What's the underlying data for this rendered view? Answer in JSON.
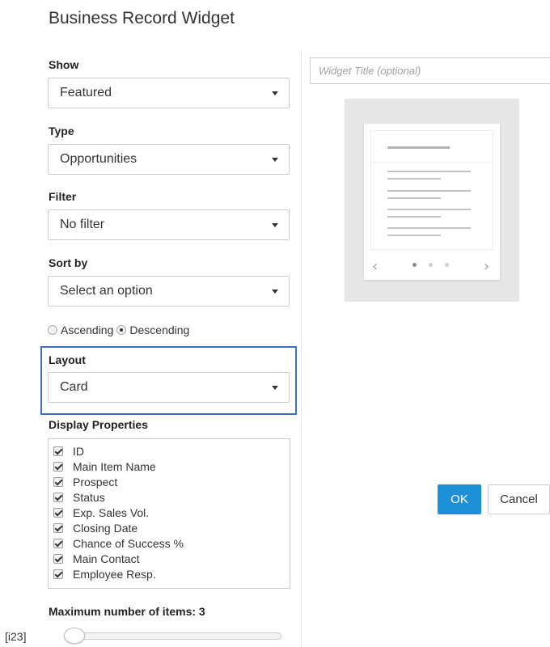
{
  "page_title": "Business Record Widget",
  "show": {
    "label": "Show",
    "value": "Featured"
  },
  "type": {
    "label": "Type",
    "value": "Opportunities"
  },
  "filter": {
    "label": "Filter",
    "value": "No filter"
  },
  "sort_by": {
    "label": "Sort by",
    "value": "Select an option",
    "order_options": [
      {
        "label": "Ascending",
        "selected": false
      },
      {
        "label": "Descending",
        "selected": true
      }
    ]
  },
  "layout": {
    "label": "Layout",
    "value": "Card",
    "focus_color": "#3f6fc4"
  },
  "display_properties": {
    "label": "Display Properties",
    "items": [
      {
        "label": "ID",
        "checked": true
      },
      {
        "label": "Main Item Name",
        "checked": true
      },
      {
        "label": "Prospect",
        "checked": true
      },
      {
        "label": "Status",
        "checked": true
      },
      {
        "label": "Exp. Sales Vol.",
        "checked": true
      },
      {
        "label": "Closing Date",
        "checked": true
      },
      {
        "label": "Chance of Success %",
        "checked": true
      },
      {
        "label": "Main Contact",
        "checked": true
      },
      {
        "label": "Employee Resp.",
        "checked": true
      }
    ]
  },
  "max_items": {
    "label": "Maximum number of items: 3",
    "value": 3
  },
  "corner_tag": "[i23]",
  "widget_title": {
    "placeholder": "Widget Title (optional)",
    "value": ""
  },
  "preview": {
    "prev_icon": "‹",
    "next_icon": "›",
    "page_count": 3,
    "active_page": 1
  },
  "actions": {
    "ok_label": "OK",
    "cancel_label": "Cancel",
    "ok_color": "#1e90d8"
  }
}
